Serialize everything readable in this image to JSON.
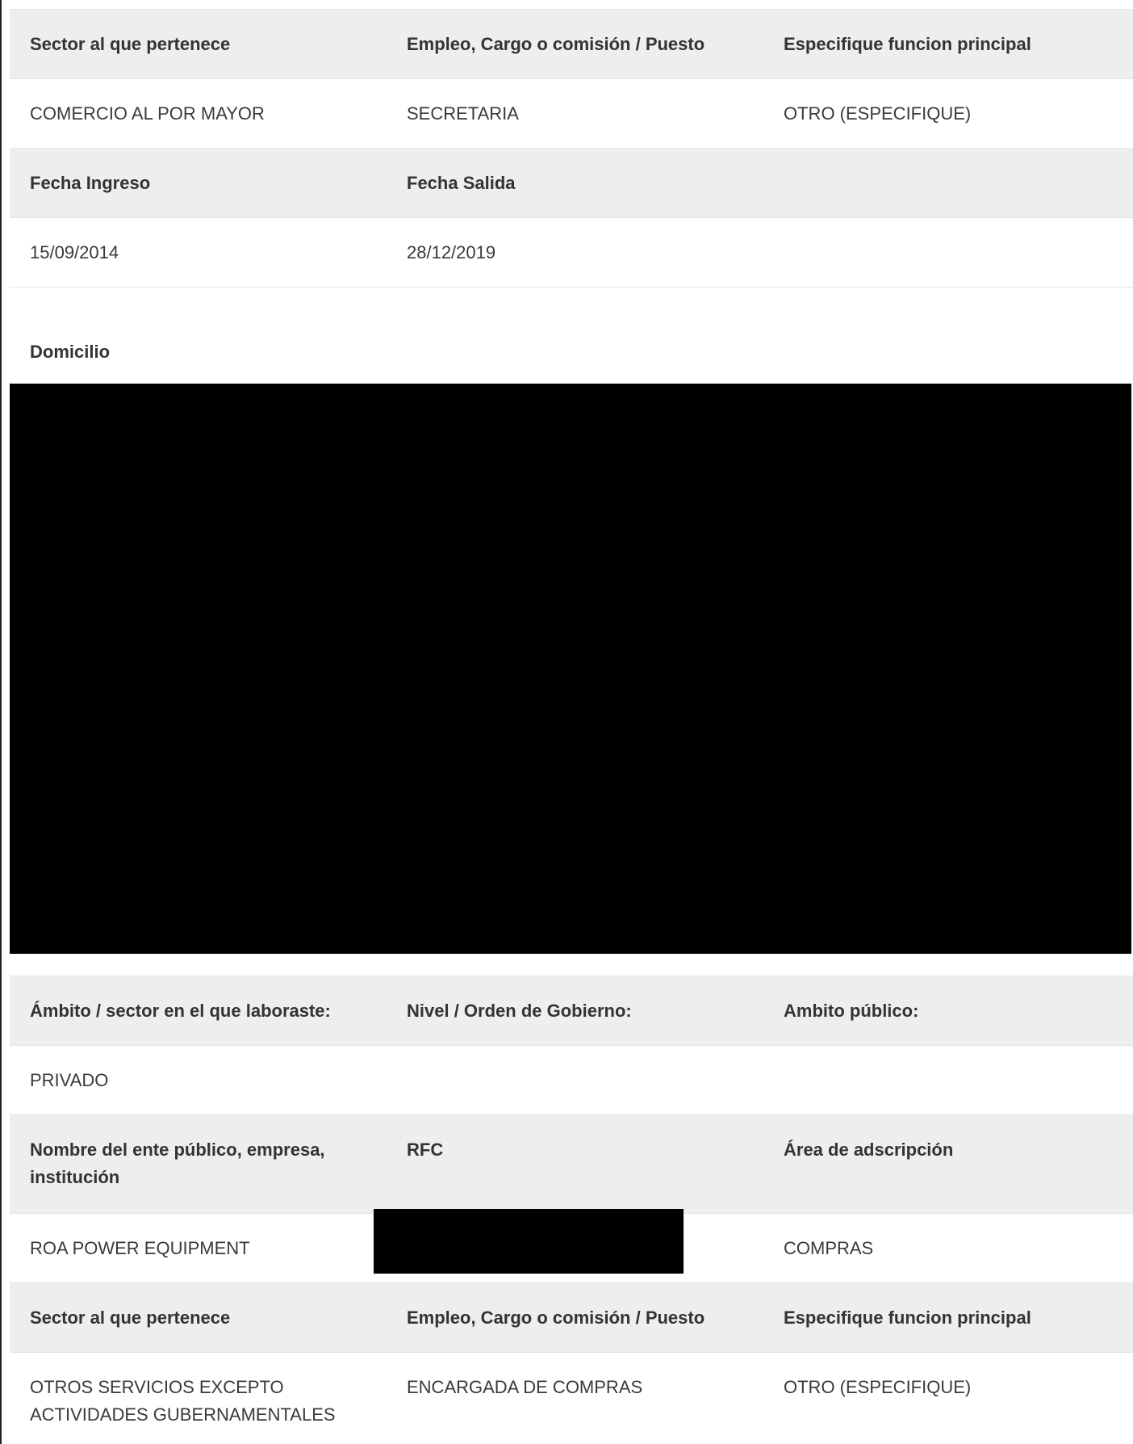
{
  "block1": {
    "header": [
      "Sector al que pertenece",
      "Empleo, Cargo o comisión / Puesto",
      "Especifique funcion principal"
    ],
    "values": [
      "COMERCIO AL POR MAYOR",
      "SECRETARIA",
      "OTRO (ESPECIFIQUE)"
    ]
  },
  "dates": {
    "header": [
      "Fecha Ingreso",
      "Fecha Salida"
    ],
    "values": [
      "15/09/2014",
      "28/12/2019"
    ]
  },
  "domicilio": {
    "label": "Domicilio"
  },
  "ambito": {
    "header": [
      "Ámbito / sector en el que laboraste:",
      "Nivel / Orden de Gobierno:",
      "Ambito público:"
    ],
    "values": [
      "PRIVADO",
      "",
      ""
    ]
  },
  "ente": {
    "header": [
      "Nombre del ente público, empresa, institución",
      "RFC",
      "Área de adscripción"
    ],
    "values": [
      "ROA POWER EQUIPMENT",
      "",
      "COMPRAS"
    ]
  },
  "block2": {
    "header": [
      "Sector al que pertenece",
      "Empleo, Cargo o comisión / Puesto",
      "Especifique funcion principal"
    ],
    "values": [
      "OTROS SERVICIOS EXCEPTO ACTIVIDADES GUBERNAMENTALES",
      "ENCARGADA DE COMPRAS",
      "OTRO (ESPECIFIQUE)"
    ]
  }
}
